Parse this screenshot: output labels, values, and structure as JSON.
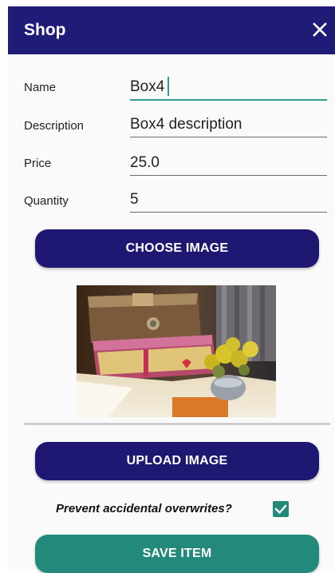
{
  "colors": {
    "app_bar": "#211b78",
    "primary_button": "#1f1873",
    "accent": "#2e9c8e",
    "save_button": "#23897b"
  },
  "header": {
    "title": "Shop",
    "close_icon": "close-icon"
  },
  "form": {
    "name": {
      "label": "Name",
      "value": "Box4"
    },
    "description": {
      "label": "Description",
      "value": "Box4 description"
    },
    "price": {
      "label": "Price",
      "value": "25.0"
    },
    "quantity": {
      "label": "Quantity",
      "value": "5"
    }
  },
  "buttons": {
    "choose_image": "CHOOSE IMAGE",
    "upload_image": "UPLOAD IMAGE",
    "save_item": "SAVE ITEM"
  },
  "prevent_overwrites": {
    "label": "Prevent accidental overwrites?",
    "checked": true
  },
  "image": {
    "subject": "gift boxes with yellow flowers"
  }
}
